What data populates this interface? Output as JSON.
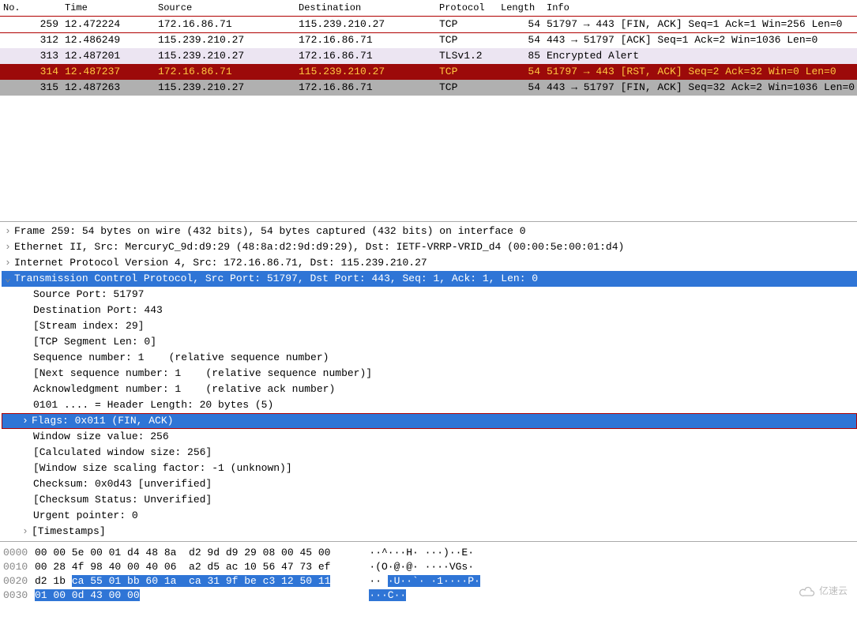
{
  "columns": {
    "no": "No.",
    "time": "Time",
    "src": "Source",
    "dst": "Destination",
    "proto": "Protocol",
    "len": "Length",
    "info": "Info"
  },
  "packets": [
    {
      "no": "259",
      "time": "12.472224",
      "src": "172.16.86.71",
      "dst": "115.239.210.27",
      "proto": "TCP",
      "len": "54",
      "info": "51797 → 443 [FIN, ACK] Seq=1 Ack=1 Win=256 Len=0",
      "cls": "row-boxed"
    },
    {
      "no": "312",
      "time": "12.486249",
      "src": "115.239.210.27",
      "dst": "172.16.86.71",
      "proto": "TCP",
      "len": "54",
      "info": "443 → 51797 [ACK] Seq=1 Ack=2 Win=1036 Len=0",
      "cls": ""
    },
    {
      "no": "313",
      "time": "12.487201",
      "src": "115.239.210.27",
      "dst": "172.16.86.71",
      "proto": "TLSv1.2",
      "len": "85",
      "info": "Encrypted Alert",
      "cls": "row-lav"
    },
    {
      "no": "314",
      "time": "12.487237",
      "src": "172.16.86.71",
      "dst": "115.239.210.27",
      "proto": "TCP",
      "len": "54",
      "info": "51797 → 443 [RST, ACK] Seq=2 Ack=32 Win=0 Len=0",
      "cls": "row-red"
    },
    {
      "no": "315",
      "time": "12.487263",
      "src": "115.239.210.27",
      "dst": "172.16.86.71",
      "proto": "TCP",
      "len": "54",
      "info": "443 → 51797 [FIN, ACK] Seq=32 Ack=2 Win=1036 Len=0",
      "cls": "row-gray"
    }
  ],
  "details": {
    "frame": "Frame 259: 54 bytes on wire (432 bits), 54 bytes captured (432 bits) on interface 0",
    "eth": "Ethernet II, Src: MercuryC_9d:d9:29 (48:8a:d2:9d:d9:29), Dst: IETF-VRRP-VRID_d4 (00:00:5e:00:01:d4)",
    "ip": "Internet Protocol Version 4, Src: 172.16.86.71, Dst: 115.239.210.27",
    "tcp": "Transmission Control Protocol, Src Port: 51797, Dst Port: 443, Seq: 1, Ack: 1, Len: 0",
    "srcport": "Source Port: 51797",
    "dstport": "Destination Port: 443",
    "stream": "[Stream index: 29]",
    "seglen": "[TCP Segment Len: 0]",
    "seq": "Sequence number: 1    (relative sequence number)",
    "nextseq": "[Next sequence number: 1    (relative sequence number)]",
    "ack": "Acknowledgment number: 1    (relative ack number)",
    "hdrlen": "0101 .... = Header Length: 20 bytes (5)",
    "flags": "Flags: 0x011 (FIN, ACK)",
    "winsize": "Window size value: 256",
    "calcwin": "[Calculated window size: 256]",
    "winscale": "[Window size scaling factor: -1 (unknown)]",
    "cksum": "Checksum: 0x0d43 [unverified]",
    "ckstat": "[Checksum Status: Unverified]",
    "urg": "Urgent pointer: 0",
    "ts": "[Timestamps]"
  },
  "hex": [
    {
      "off": "0000",
      "b": "00 00 5e 00 01 d4 48 8a  d2 9d d9 29 08 00 45 00",
      "a": "··^···H· ···)··E·",
      "sel": false
    },
    {
      "off": "0010",
      "b": "00 28 4f 98 40 00 40 06  a2 d5 ac 10 56 47 73 ef",
      "a": "·(O·@·@· ····VGs·",
      "sel": false
    },
    {
      "off": "0020",
      "b_pre": "d2 1b ",
      "b_sel": "ca 55 01 bb 60 1a  ca 31 9f be c3 12 50 11",
      "a_pre": "·· ",
      "a_sel": "·U··`· ·1····P·",
      "sel": true
    },
    {
      "off": "0030",
      "b_pre": "",
      "b_sel": "01 00 0d 43 00 00",
      "a_pre": "",
      "a_sel": "···C··",
      "sel": true
    }
  ],
  "watermark": "亿速云"
}
